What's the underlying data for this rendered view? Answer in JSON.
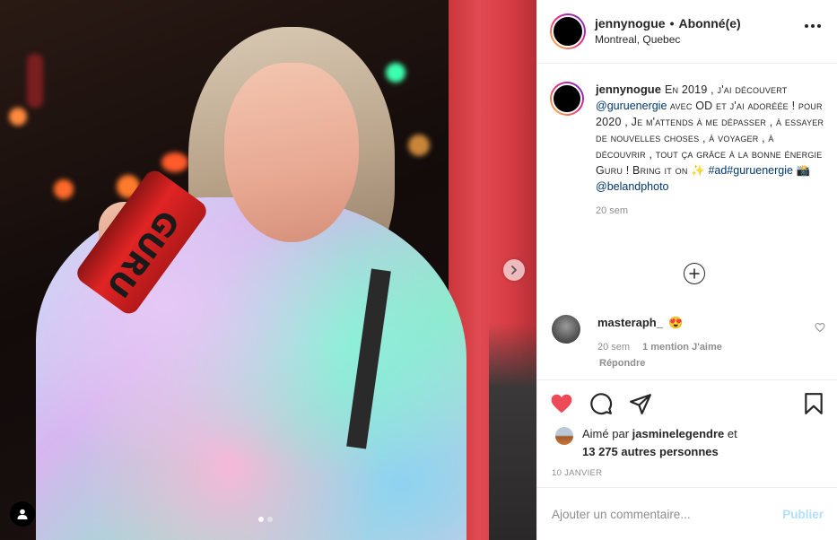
{
  "post": {
    "username": "jennynogue",
    "separator": "•",
    "follow_status": "Abonné(e)",
    "location": "Montreal, Quebec"
  },
  "caption": {
    "username": "jennynogue",
    "text_1": "En 2019 , j'ai découvert",
    "mention_1": "@guruenergie",
    "text_2": "avec OD et j'ai adoréée ! pour 2020 , Je m'attends à me dépasser , à essayer de nouvelles choses , à voyager , à découvrir , tout ça grâce à la bonne énergie Guru ! Bring it on ✨",
    "hashtags": "#ad#guruenergie",
    "camera_emoji": "📸",
    "mention_2": "@belandphoto",
    "time": "20 sem"
  },
  "comment": {
    "username": "masteraph_",
    "emoji": "😍",
    "time": "20 sem",
    "likes": "1 mention J'aime",
    "reply": "Répondre"
  },
  "likes": {
    "prefix": "Aimé par",
    "user": "jasminelegendre",
    "suffix": "et",
    "others": "13 275 autres personnes"
  },
  "date": "10 JANVIER",
  "add_comment": {
    "placeholder": "Ajouter un commentaire...",
    "publish": "Publier"
  },
  "image": {
    "can_text": "GURU"
  },
  "colors": {
    "heart": "#ed4956",
    "link": "#00376b",
    "publish_disabled": "#b2dffc"
  },
  "icons": [
    "next-arrow-icon",
    "user-tag-icon",
    "more-options-icon",
    "add-circle-icon",
    "heart-icon",
    "comment-icon",
    "share-icon",
    "bookmark-icon"
  ]
}
